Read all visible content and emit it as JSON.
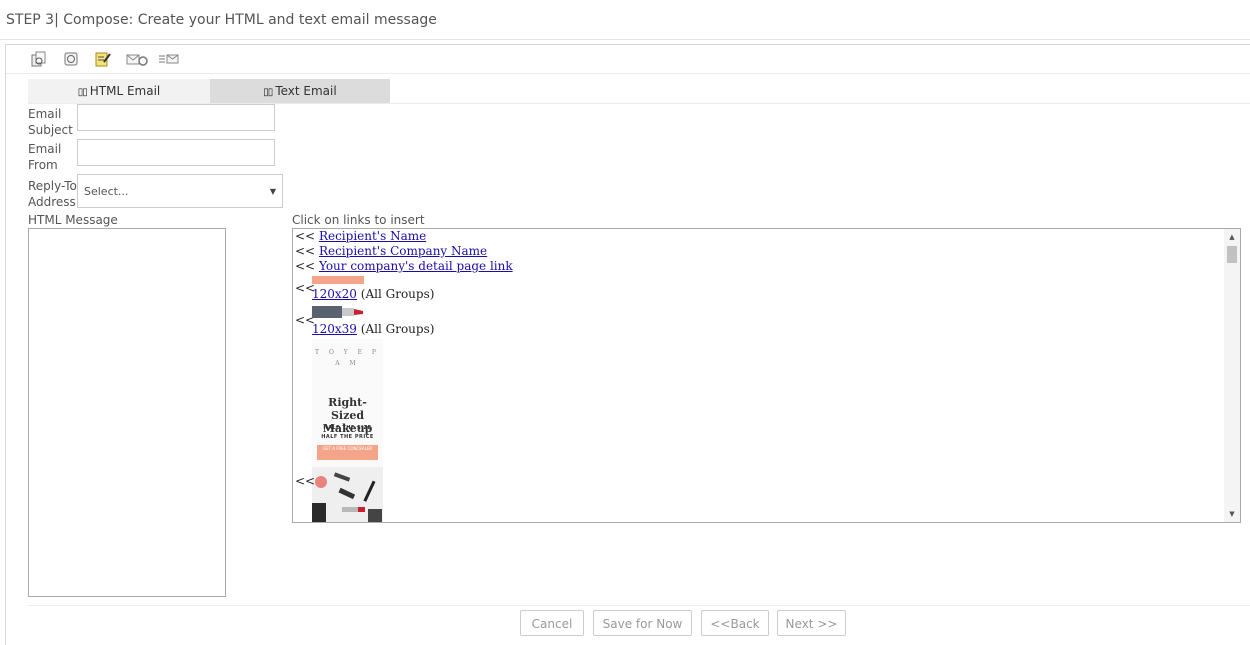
{
  "step_title": "STEP 3| Compose: Create your HTML and text email message",
  "toolbar": {
    "icons": [
      "copy-doc-icon",
      "camera-icon",
      "edit-note-icon",
      "send-refresh-icon",
      "list-mail-icon"
    ]
  },
  "tabs": [
    {
      "label": "HTML Email",
      "active": true
    },
    {
      "label": "Text Email",
      "active": false
    }
  ],
  "form": {
    "subject_label": "Email Subject",
    "subject_label_line1": "Email",
    "subject_label_line2": "Subject",
    "subject_value": "",
    "from_label_line1": "Email",
    "from_label_line2": "From",
    "from_value": "",
    "replyto_label_line1": "Reply-To",
    "replyto_label_line2": "Address",
    "replyto_selected": "Select...",
    "html_message_label": "HTML Message",
    "html_message_value": ""
  },
  "insert_panel": {
    "label": "Click on links to insert",
    "prefix": "<<",
    "links": [
      "Recipient's Name",
      "Recipient's Company Name",
      "Your company's detail page link"
    ],
    "banners": [
      {
        "size_link": "120x20",
        "group": "(All Groups)"
      },
      {
        "size_link": "120x39",
        "group": "(All Groups)"
      }
    ],
    "ad": {
      "headline_line1": "Right-Sized",
      "headline_line2": "Makeup",
      "sub_line1": "HALF THE SIZE",
      "sub_line2": "HALF THE PRICE",
      "cta": "GET A FREE CONCEALER",
      "dots": "T O Y E P A M"
    }
  },
  "footer": {
    "cancel": "Cancel",
    "save": "Save for Now",
    "back": "<<Back",
    "next": "Next >>"
  },
  "colors": {
    "link": "#1a0dab",
    "promo": "#f2a58a",
    "inactive_tab": "#dcdcdc"
  }
}
